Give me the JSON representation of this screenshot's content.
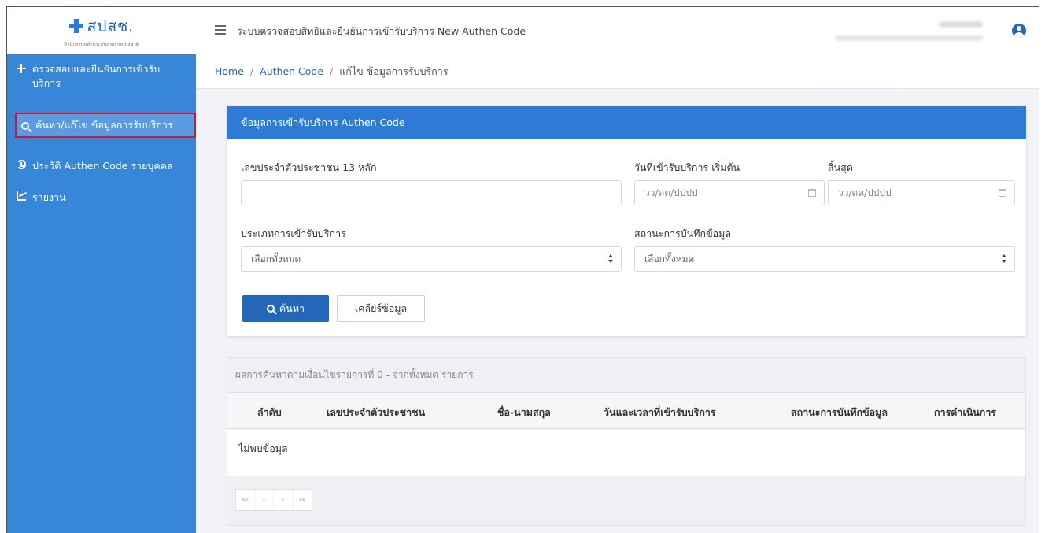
{
  "logo": {
    "text": "สปสช.",
    "sub": "สำนักงานหลักประกันสุขภาพแห่งชาติ"
  },
  "header": {
    "title": "ระบบตรวจสอบสิทธิและยืนยันการเข้ารับบริการ New Authen Code"
  },
  "sidebar": {
    "items": [
      {
        "label": "ตรวจสอบและยืนยันการเข้ารับบริการ",
        "icon": "plus-icon"
      },
      {
        "label": "ค้นหา/แก้ไข ข้อมูลการรับบริการ",
        "icon": "search-icon",
        "active": true
      },
      {
        "label": "ประวัติ Authen Code รายบุคคล",
        "icon": "history-icon"
      },
      {
        "label": "รายงาน",
        "icon": "chart-icon"
      }
    ]
  },
  "breadcrumb": {
    "home": "Home",
    "section": "Authen Code",
    "current": "แก้ไข ข้อมูลการรับบริการ",
    "sep": "/"
  },
  "form": {
    "panel_title": "ข้อมูลการเข้ารับบริการ Authen Code",
    "id_label": "เลขประจำตัวประชาชน 13 หลัก",
    "id_value": "",
    "start_label": "วันที่เข้ารับบริการ เริ่มต้น",
    "start_placeholder": "วว/ดด/ปปปป",
    "end_label": "สิ้นสุด",
    "end_placeholder": "วว/ดด/ปปปป",
    "type_label": "ประเภทการเข้ารับบริการ",
    "type_value": "เลือกทั้งหมด",
    "status_label": "สถานะการบันทึกข้อมูล",
    "status_value": "เลือกทั้งหมด",
    "search_button": "ค้นหา",
    "clear_button": "เคลียร์ข้อมูล"
  },
  "results": {
    "summary": "ผลการค้นหาตามเงื่อนไขรายการที่ 0 - จากทั้งหมด รายการ",
    "columns": [
      "ลำดับ",
      "เลขประจำตัวประชาชน",
      "ชื่อ-นามสกุล",
      "วันและเวลาที่เข้ารับบริการ",
      "สถานะการบันทึกข้อมูล",
      "การดำเนินการ"
    ],
    "empty_text": "ไม่พบข้อมูล",
    "pager": [
      "«‹",
      "‹",
      "›",
      "›»"
    ]
  },
  "colors": {
    "sidebar": "#3886d8",
    "panel_header": "#2e7bd6",
    "button": "#2466b8",
    "highlight": "#d9152a"
  }
}
